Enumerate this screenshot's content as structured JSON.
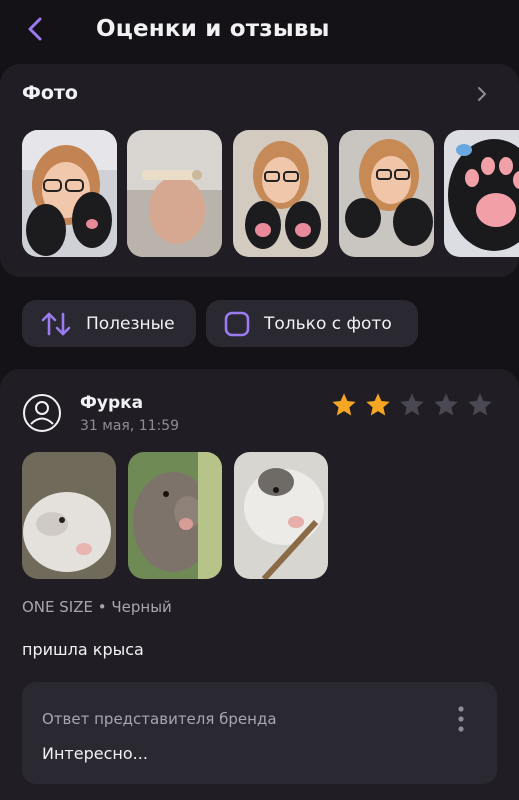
{
  "header": {
    "title": "Оценки и отзывы",
    "back_icon": "chevron-left-icon"
  },
  "photo_section": {
    "title": "Фото",
    "arrow_icon": "chevron-right-icon",
    "thumbnails": [
      "girl-with-cat-paw-gloves",
      "glove-label",
      "girl-showing-paw-gloves",
      "girl-smiling-in-gloves",
      "paw-glove-closeup"
    ]
  },
  "filters": {
    "sort_label": "Полезные",
    "sort_icon": "sort-arrows-icon",
    "photo_only_label": "Только с фото",
    "photo_only_checked": false
  },
  "review": {
    "author": "Фурка",
    "date": "31 мая, 11:59",
    "rating": 2,
    "rating_max": 5,
    "photos": [
      "white-rat",
      "grey-rat",
      "rat-with-stick"
    ],
    "variant": "ONE SIZE • Черный",
    "text": "пришла крыса",
    "brand_reply": {
      "title": "Ответ представителя бренда",
      "text": "Интересно..."
    }
  },
  "colors": {
    "accent": "#9b7bf0",
    "star_filled": "#f5a623",
    "star_empty": "#4a4852",
    "background": "#141216",
    "card": "#201e24"
  }
}
